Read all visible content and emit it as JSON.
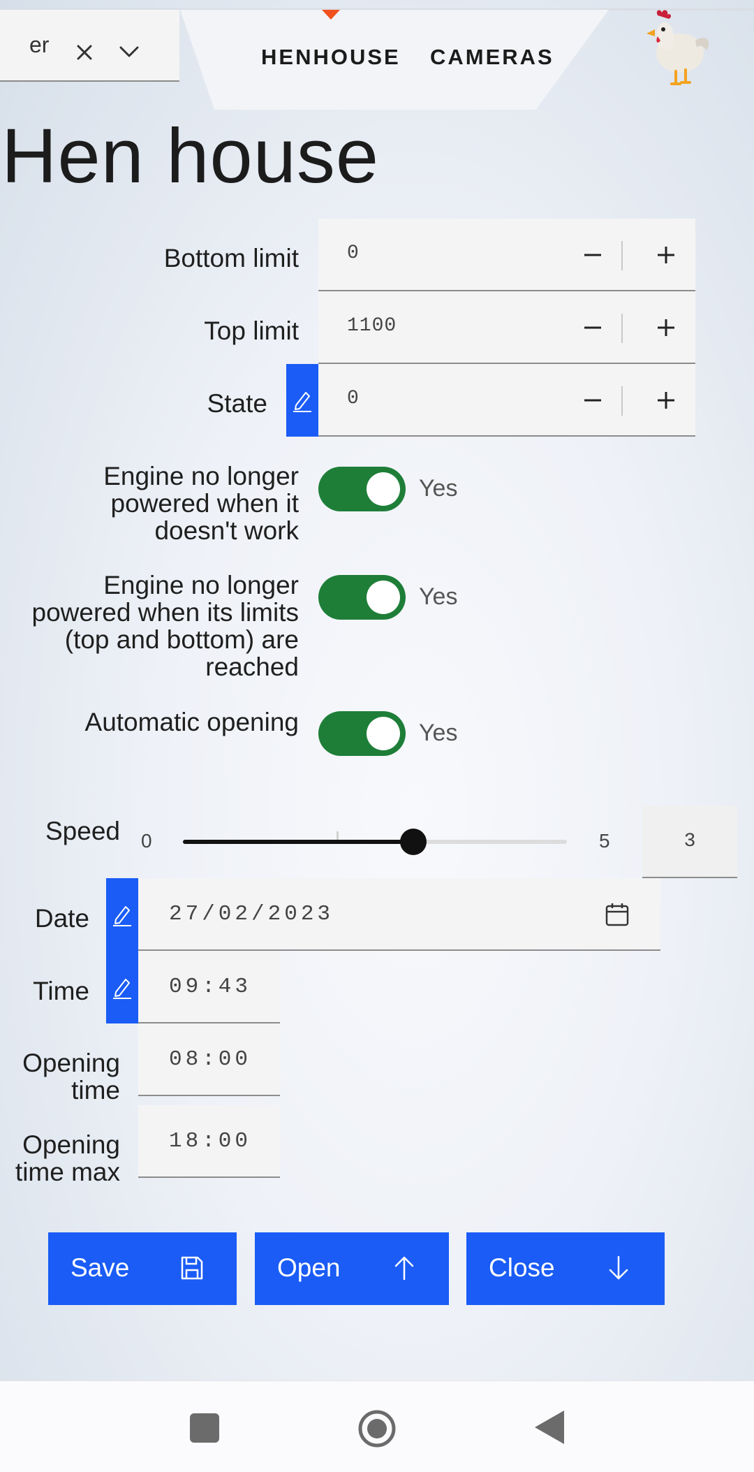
{
  "selector": {
    "value": "er"
  },
  "nav": {
    "tabs": [
      "HENHOUSE",
      "CAMERAS"
    ]
  },
  "page": {
    "title": "Hen house"
  },
  "form": {
    "bottom_limit": {
      "label": "Bottom limit",
      "value": "0"
    },
    "top_limit": {
      "label": "Top limit",
      "value": "1100"
    },
    "state": {
      "label": "State",
      "value": "0"
    },
    "toggles": [
      {
        "label": "Engine no longer powered when it doesn't work",
        "value": "Yes",
        "on": true
      },
      {
        "label": "Engine no longer powered when its limits (top and bottom) are reached",
        "value": "Yes",
        "on": true
      },
      {
        "label": "Automatic opening",
        "value": "Yes",
        "on": true
      }
    ],
    "speed": {
      "label": "Speed",
      "min": "0",
      "max": "5",
      "value": "3"
    },
    "date": {
      "label": "Date",
      "value": "27/02/2023"
    },
    "time": {
      "label": "Time",
      "value": "09:43"
    },
    "opening_time": {
      "label": "Opening time",
      "value": "08:00"
    },
    "opening_time_max": {
      "label": "Opening time max",
      "value": "18:00"
    }
  },
  "actions": {
    "save": "Save",
    "open": "Open",
    "close": "Close"
  },
  "colors": {
    "accent": "#1a5cf5",
    "toggle_on": "#1e7e38",
    "indicator": "#f0511e"
  },
  "icons": [
    "close-icon",
    "chevron-down-icon",
    "hen-logo",
    "minus-icon",
    "plus-icon",
    "pencil-icon",
    "calendar-icon",
    "save-icon",
    "arrow-up-icon",
    "arrow-down-icon"
  ]
}
